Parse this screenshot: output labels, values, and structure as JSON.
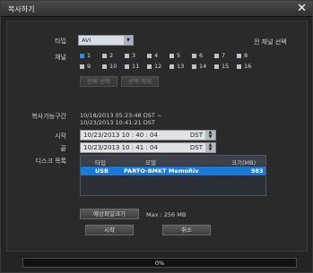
{
  "dialog": {
    "title": "복사하기",
    "close_glyph": "✕"
  },
  "labels": {
    "type": "타입",
    "channel": "채널",
    "range": "복사가능구간",
    "start": "시작",
    "end": "끝",
    "disk_list": "디스크 목록"
  },
  "type_select": {
    "value": "AVI",
    "arrow": "▼"
  },
  "select_all": "전 채널 선택",
  "channels": [
    {
      "num": "1",
      "checked": true
    },
    {
      "num": "2",
      "checked": false
    },
    {
      "num": "3",
      "checked": false
    },
    {
      "num": "4",
      "checked": false
    },
    {
      "num": "5",
      "checked": false
    },
    {
      "num": "6",
      "checked": false
    },
    {
      "num": "7",
      "checked": false
    },
    {
      "num": "8",
      "checked": false
    },
    {
      "num": "9",
      "checked": false
    },
    {
      "num": "10",
      "checked": false
    },
    {
      "num": "11",
      "checked": false
    },
    {
      "num": "12",
      "checked": false
    },
    {
      "num": "13",
      "checked": false
    },
    {
      "num": "14",
      "checked": false
    },
    {
      "num": "15",
      "checked": false
    },
    {
      "num": "16",
      "checked": false
    }
  ],
  "disabled_buttons": {
    "b1": "전체 선택",
    "b2": "선택 해제"
  },
  "copy_range": {
    "line1": "10/18/2013 05:23:48 DST ~",
    "line2": "10/23/2013 10:41:21 DST"
  },
  "start_time": {
    "value": "10/23/2013 10 : 40 : 04",
    "dst": "DST"
  },
  "end_time": {
    "value": "10/23/2013 10 : 41 : 04",
    "dst": "DST"
  },
  "spin": {
    "up": "▲",
    "down": "▼"
  },
  "disk_table": {
    "columns": [
      "타입",
      "모델",
      "크기(MB)"
    ],
    "rows": [
      {
        "type": "USB",
        "model": "PARTO-BMKT MemoRiv",
        "size": "983"
      }
    ]
  },
  "size_button": "예상파일크기",
  "max_size": "Max : 256 MB",
  "actions": {
    "start": "시작",
    "cancel": "취소"
  },
  "progress": {
    "percent": 0,
    "label": "0%"
  }
}
